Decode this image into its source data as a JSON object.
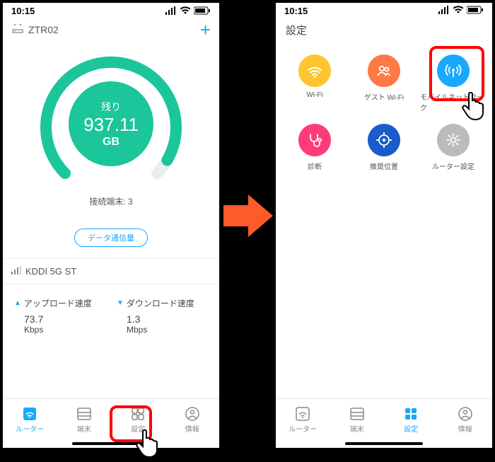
{
  "status": {
    "time": "10:15"
  },
  "left": {
    "device": "ZTR02",
    "gauge": {
      "label": "残り",
      "value": "937.11",
      "unit": "GB"
    },
    "connected_label": "接続端末:",
    "connected_count": "3",
    "data_button": "データ通信量",
    "carrier": "KDDI  5G  ST",
    "upload": {
      "label": "アップロード速度",
      "value": "73.7",
      "unit": "Kbps"
    },
    "download": {
      "label": "ダウンロード速度",
      "value": "1.3",
      "unit": "Mbps"
    },
    "tabs": {
      "router": "ルーター",
      "devices": "端末",
      "settings": "設定",
      "info": "情報"
    }
  },
  "right": {
    "title": "設定",
    "items": {
      "wifi": "Wi-Fi",
      "guest": "ゲスト Wi-Fi",
      "mobile": "モバイルネットワーク",
      "diag": "診断",
      "rec": "推奨位置",
      "router": "ルーター設定"
    },
    "tabs": {
      "router": "ルーター",
      "devices": "端末",
      "settings": "設定",
      "info": "情報"
    }
  }
}
